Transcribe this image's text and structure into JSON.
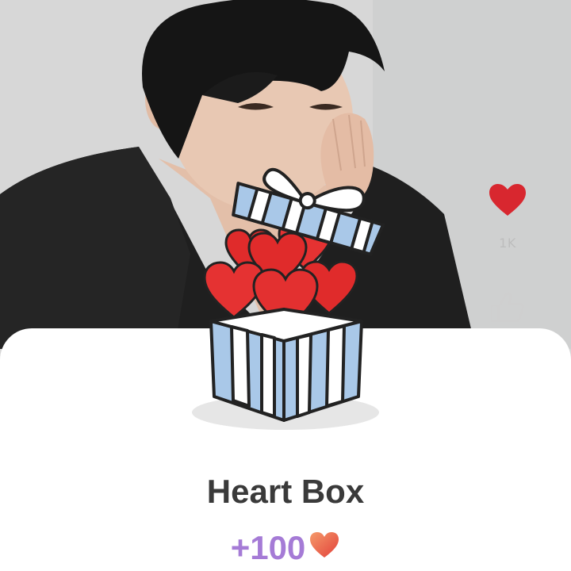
{
  "background": {
    "wall_color": "#d6d6d6",
    "jacket_color": "#1e1e1e",
    "hair_color": "#141414",
    "skin_color": "#e6c3ad"
  },
  "action_rail": {
    "heart_icon": "heart-icon",
    "heart_color": "#d8272f",
    "like_count": "1K",
    "like_icon": "thumbs-up-icon"
  },
  "reward_sheet": {
    "title": "Heart Box",
    "reward_amount": "+100",
    "reward_icon": "heart-icon",
    "gift_icon": "gift-box-icon",
    "colors": {
      "title": "#3a3a3a",
      "amount": "#a57bd6",
      "box_blue": "#a9c8e8",
      "hearts_red": "#e02b2b"
    }
  }
}
